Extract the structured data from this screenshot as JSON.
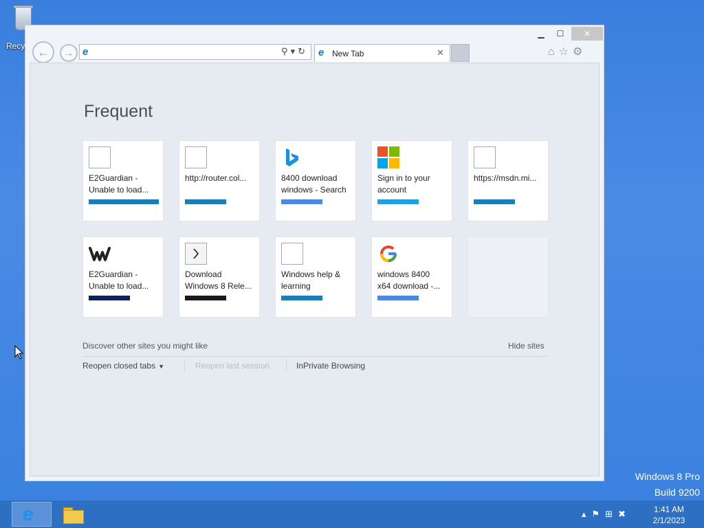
{
  "desktop": {
    "recycle_label": "Recycle Bin",
    "recycle_label_visible": "Recyc",
    "watermark_line1": "Windows 8 Pro",
    "watermark_line2": "Build 9200"
  },
  "window": {
    "tab_title": "New Tab",
    "address_value": "",
    "controls": {
      "minimize": "▁",
      "maximize": "☐",
      "close": "✕"
    }
  },
  "new_tab_page": {
    "heading": "Frequent",
    "tiles": [
      {
        "line1": "E2Guardian -",
        "line2": "Unable to load...",
        "icon": "blank-page-icon",
        "bar_color": "#1b7fb6"
      },
      {
        "line1": "http://router.col...",
        "line2": "",
        "icon": "blank-page-icon",
        "bar_color": "#1b7fb6"
      },
      {
        "line1": "8400 download",
        "line2": "windows - Search",
        "icon": "bing-logo-icon",
        "bar_color": "#4a8ae0"
      },
      {
        "line1": "Sign in to your",
        "line2": "account",
        "icon": "microsoft-logo-icon",
        "bar_color": "#23a0e0"
      },
      {
        "line1": "https://msdn.mi...",
        "line2": "",
        "icon": "blank-page-icon",
        "bar_color": "#1b7fb6"
      },
      {
        "line1": "E2Guardian -",
        "line2": "Unable to load...",
        "icon": "weebly-logo-icon",
        "bar_color": "#0d2354"
      },
      {
        "line1": "Download",
        "line2": "Windows 8 Rele...",
        "icon": "chevron-logo-icon",
        "bar_color": "#1a1a1a"
      },
      {
        "line1": "Windows help &",
        "line2": "learning",
        "icon": "blank-page-icon",
        "bar_color": "#1b7fb6"
      },
      {
        "line1": "windows 8400",
        "line2": "x64 download -...",
        "icon": "google-logo-icon",
        "bar_color": "#4a8ae0"
      }
    ],
    "discover_text": "Discover other sites you might like",
    "hide_sites": "Hide sites",
    "reopen_closed_tabs": "Reopen closed tabs",
    "reopen_last_session": "Reopen last session",
    "inprivate": "InPrivate Browsing"
  },
  "taskbar": {
    "time": "1:41 AM",
    "date": "2/1/2023",
    "tray_icons": [
      "chevron-up-icon",
      "flag-icon",
      "network-icon",
      "volume-muted-icon"
    ]
  }
}
